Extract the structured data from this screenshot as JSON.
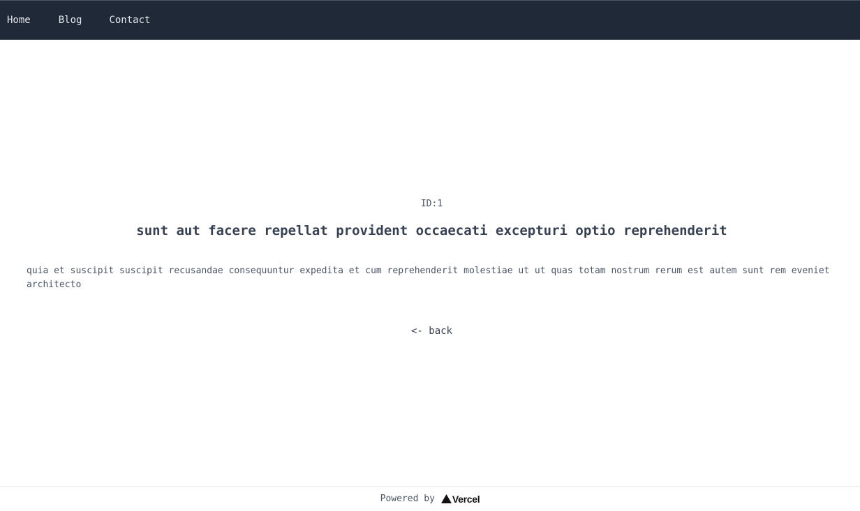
{
  "nav": {
    "items": [
      {
        "label": "Home"
      },
      {
        "label": "Blog"
      },
      {
        "label": "Contact"
      }
    ]
  },
  "post": {
    "id_label": "ID:1",
    "title": "sunt aut facere repellat provident occaecati excepturi optio reprehenderit",
    "body": "quia et suscipit suscipit recusandae consequuntur expedita et cum reprehenderit molestiae ut ut quas totam nostrum rerum est autem sunt rem eveniet architecto",
    "back_label": "<- back"
  },
  "footer": {
    "powered_by": "Powered by",
    "brand": "Vercel"
  },
  "colors": {
    "nav_bg": "#1f2937",
    "nav_text": "#e5e7eb",
    "text": "#374151"
  },
  "icons": {
    "brand_logo": "vercel-triangle-icon"
  }
}
